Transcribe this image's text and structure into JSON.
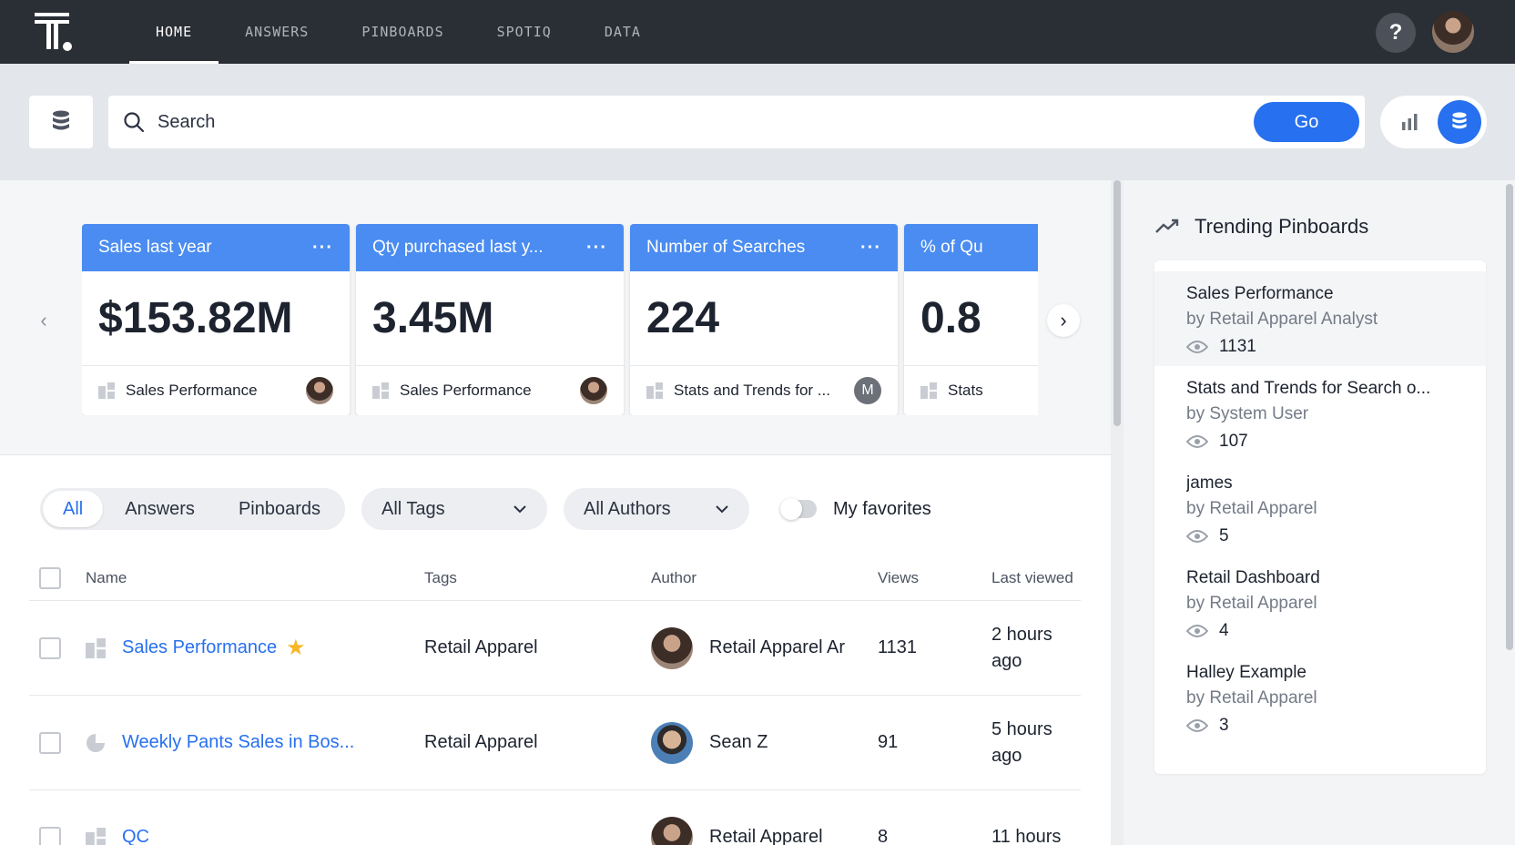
{
  "nav": {
    "items": [
      {
        "label": "HOME",
        "active": true
      },
      {
        "label": "ANSWERS",
        "active": false
      },
      {
        "label": "PINBOARDS",
        "active": false
      },
      {
        "label": "SPOTIQ",
        "active": false
      },
      {
        "label": "DATA",
        "active": false
      }
    ],
    "help_label": "?"
  },
  "search": {
    "placeholder": "Search",
    "go_label": "Go"
  },
  "kpi_cards": [
    {
      "title": "Sales last year",
      "value": "$153.82M",
      "source": "Sales Performance",
      "menu": "···"
    },
    {
      "title": "Qty purchased last y...",
      "value": "3.45M",
      "source": "Sales Performance",
      "menu": "···"
    },
    {
      "title": "Number of Searches",
      "value": "224",
      "source": "Stats and Trends for ...",
      "menu": "···",
      "avatar_letter": "M"
    },
    {
      "title": "% of Qu",
      "value": "0.8",
      "source": "Stats"
    }
  ],
  "carousel": {
    "prev": "‹",
    "next": "›"
  },
  "filters": {
    "segments": [
      "All",
      "Answers",
      "Pinboards"
    ],
    "tags_label": "All Tags",
    "authors_label": "All Authors",
    "favorites_label": "My favorites"
  },
  "table": {
    "headers": {
      "name": "Name",
      "tags": "Tags",
      "author": "Author",
      "views": "Views",
      "last_viewed": "Last viewed"
    },
    "rows": [
      {
        "name": "Sales Performance",
        "starred": true,
        "tags": "Retail Apparel",
        "author": "Retail Apparel Ar",
        "views": "1131",
        "last_viewed": "2 hours ago"
      },
      {
        "name": "Weekly Pants Sales in Bos...",
        "starred": false,
        "tags": "Retail Apparel",
        "author": "Sean Z",
        "views": "91",
        "last_viewed": "5 hours ago"
      },
      {
        "name": "QC",
        "starred": false,
        "tags": "",
        "author": "Retail Apparel",
        "views": "8",
        "last_viewed": "11 hours"
      }
    ]
  },
  "trending": {
    "title": "Trending Pinboards",
    "items": [
      {
        "title": "Sales Performance",
        "by": "by Retail Apparel Analyst",
        "views": "1131"
      },
      {
        "title": "Stats and Trends for Search o...",
        "by": "by System User",
        "views": "107"
      },
      {
        "title": "james",
        "by": "by Retail Apparel",
        "views": "5"
      },
      {
        "title": "Retail Dashboard",
        "by": "by Retail Apparel",
        "views": "4"
      },
      {
        "title": "Halley Example",
        "by": "by Retail Apparel",
        "views": "3"
      }
    ]
  },
  "colors": {
    "accent": "#2770ef",
    "card_header": "#4a8cf1",
    "nav_bg": "#2a2e35",
    "star": "#f5b727"
  }
}
